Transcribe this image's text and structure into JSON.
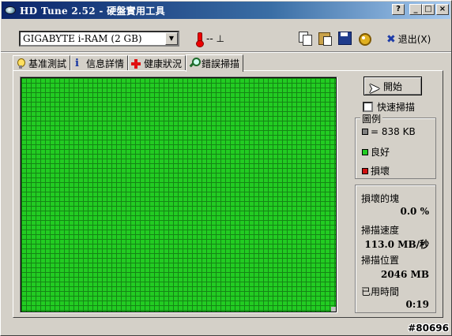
{
  "window": {
    "title": "HD Tune 2.52 - 硬盤實用工具",
    "buttons": {
      "help": "?",
      "minimize": "_",
      "maximize": "□",
      "close": "×"
    }
  },
  "toolbar": {
    "drive": "GIGABYTE i-RAM (2 GB)",
    "temperature": "-- ⊥",
    "exit_label": "退出(X)",
    "icons": [
      "copy-icon",
      "paste-icon",
      "save-icon",
      "options-icon",
      "exit-icon"
    ]
  },
  "tabs": [
    {
      "label": "基准測試",
      "icon": "bulb-icon",
      "active": false
    },
    {
      "label": "信息詳情",
      "icon": "info-icon",
      "active": false
    },
    {
      "label": "健康狀況",
      "icon": "health-icon",
      "active": false
    },
    {
      "label": "錯誤掃描",
      "icon": "magnifier-icon",
      "active": true
    }
  ],
  "scan": {
    "start_label": "開始",
    "quick_scan_label": "快速掃描",
    "quick_scan_checked": false,
    "progress_fraction": 1.0
  },
  "legend": {
    "title": "圖例",
    "items": [
      {
        "label": "= 838 KB",
        "color": "#808080"
      },
      {
        "label": "良好",
        "color": "#22cc22"
      },
      {
        "label": "損壞",
        "color": "#d01010"
      }
    ]
  },
  "stats": {
    "damaged_label": "損壞的塊",
    "damaged_value": "0.0 %",
    "speed_label": "掃描速度",
    "speed_value": "113.0 MB/秒",
    "position_label": "掃描位置",
    "position_value": "2046 MB",
    "time_label": "已用時間",
    "time_value": "0:19"
  },
  "watermark": "#80696"
}
